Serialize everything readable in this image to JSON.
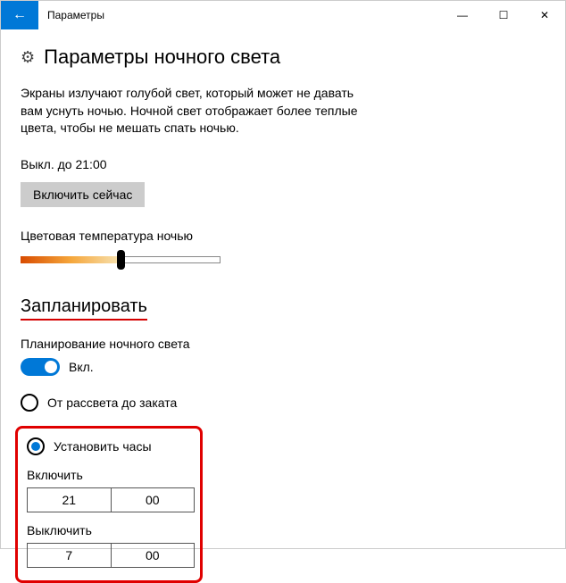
{
  "titlebar": {
    "back_glyph": "←",
    "title": "Параметры",
    "min_glyph": "—",
    "max_glyph": "☐",
    "close_glyph": "✕"
  },
  "heading": {
    "gear_glyph": "⚙",
    "title": "Параметры ночного света"
  },
  "description": "Экраны излучают голубой свет, который может не давать вам уснуть ночью. Ночной свет отображает более теплые цвета, чтобы не мешать спать ночью.",
  "status": "Выкл. до 21:00",
  "enable_now": "Включить сейчас",
  "color_temp_label": "Цветовая температура ночью",
  "schedule": {
    "title": "Запланировать",
    "toggle_label": "Планирование ночного света",
    "toggle_state": "Вкл.",
    "radio_sunset": "От рассвета до заката",
    "radio_custom": "Установить часы",
    "turn_on_label": "Включить",
    "turn_on_hours": "21",
    "turn_on_minutes": "00",
    "turn_off_label": "Выключить",
    "turn_off_hours": "7",
    "turn_off_minutes": "00"
  }
}
